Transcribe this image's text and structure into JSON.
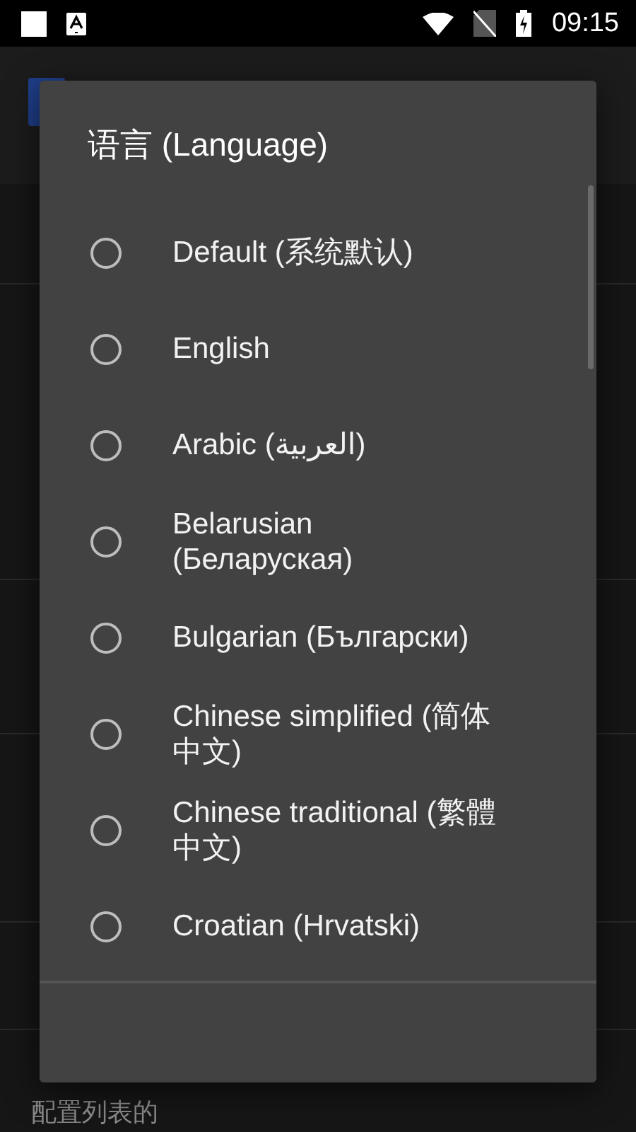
{
  "status_bar": {
    "time": "09:15"
  },
  "background": {
    "last_row_subtitle": "配置列表的"
  },
  "dialog": {
    "title": "语言 (Language)",
    "options": [
      {
        "label": "Default (系统默认)",
        "selected": false
      },
      {
        "label": "English",
        "selected": false
      },
      {
        "label": "Arabic (العربية)",
        "selected": false
      },
      {
        "label": "Belarusian (Беларуская)",
        "selected": false
      },
      {
        "label": "Bulgarian (Български)",
        "selected": false
      },
      {
        "label": "Chinese simplified (简体中文)",
        "selected": false
      },
      {
        "label": "Chinese traditional (繁體中文)",
        "selected": false
      },
      {
        "label": "Croatian (Hrvatski)",
        "selected": false
      }
    ]
  }
}
